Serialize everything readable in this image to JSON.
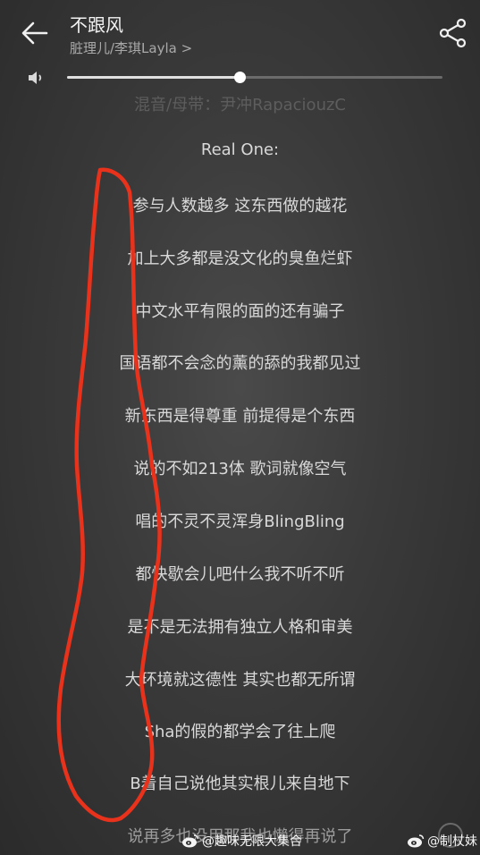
{
  "header": {
    "title": "不跟风",
    "artist": "脏理儿/李琪Layla",
    "artist_chevron": ">",
    "back_icon": "back-arrow-icon",
    "share_icon": "share-icon"
  },
  "volume": {
    "icon": "speaker-icon",
    "level_fraction": 0.46
  },
  "lyrics": {
    "lines": [
      "混音/母带：尹冲RapaciouzC",
      "Real One:",
      "参与人数越多 这东西做的越花",
      "加上大多都是没文化的臭鱼烂虾",
      "中文水平有限的面的还有骗子",
      "国语都不会念的薰的舔的我都见过",
      "新东西是得尊重 前提得是个东西",
      "说的不如213体 歌词就像空气",
      "唱的不灵不灵浑身BlingBling",
      "都快歇会儿吧什么我不听不听",
      "是不是无法拥有独立人格和审美",
      "大环境就这德性 其实也都无所谓",
      "Sha的假的都学会了往上爬",
      "B着自己说他其实根儿来自地下",
      "说再多也没用那我也懒得再说了"
    ]
  },
  "watermarks": [
    "@趣味无限大集合",
    "@制杖妹"
  ],
  "colors": {
    "annotation": "#e8321c",
    "background": "#3a3a3a"
  }
}
